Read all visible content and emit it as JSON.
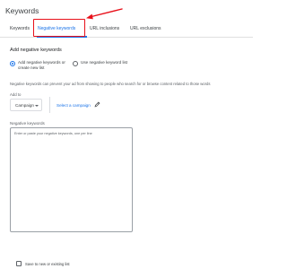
{
  "page": {
    "title": "Keywords"
  },
  "tabs": [
    {
      "label": "Keywords"
    },
    {
      "label": "Negative keywords"
    },
    {
      "label": "URL inclusions"
    },
    {
      "label": "URL exclusions"
    }
  ],
  "section": {
    "title": "Add negative keywords"
  },
  "options": [
    {
      "label": "Add negative keywords or create new list",
      "selected": true
    },
    {
      "label": "Use negative keyword list",
      "selected": false
    }
  ],
  "help_text": "Negative keywords can prevent your ad from showing to people who search for or browse content related to those words",
  "add_to": {
    "label": "Add to",
    "select_value": "Campaign",
    "link_label": "Select a campaign"
  },
  "negative_keywords": {
    "label": "Negative keywords",
    "placeholder": "Enter or paste your negative keywords, one per line"
  },
  "save_option": {
    "label": "Save to new or existing list"
  },
  "colors": {
    "accent": "#1a73e8",
    "annotation": "#e8101a"
  },
  "icons": [
    "caret-down-icon",
    "pencil-icon",
    "arrow-annotation"
  ]
}
